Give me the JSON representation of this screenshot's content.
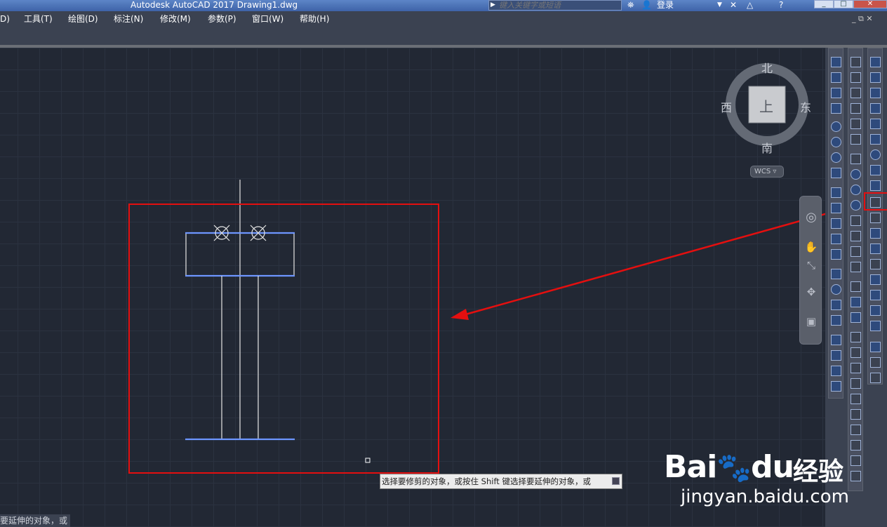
{
  "window": {
    "title": "Autodesk AutoCAD 2017    Drawing1.dwg",
    "search_placeholder": "键入关键字或短语",
    "login_label": "登录",
    "help_label": "?"
  },
  "menu": {
    "items": [
      "D)",
      "工具(T)",
      "绘图(D)",
      "标注(N)",
      "修改(M)",
      "参数(P)",
      "窗口(W)",
      "帮助(H)"
    ],
    "controls": "_ ⧉ ✕"
  },
  "viewcube": {
    "north": "北",
    "south": "南",
    "east": "东",
    "west": "西",
    "face": "上",
    "wcs_label": "WCS"
  },
  "tooltip": {
    "text": "选择要修剪的对象，或按住 Shift 键选择要延伸的对象，或"
  },
  "command_line": {
    "text": "要延伸的对象，或"
  },
  "watermark": {
    "brand": "Bai",
    "brand2": "du",
    "cn": "经验",
    "url": "jingyan.baidu.com"
  },
  "colors": {
    "annotation_red": "#e40f0f",
    "canvas_bg": "#222834",
    "highlight_blue": "#4d7fff"
  },
  "icons": {
    "paw": "paw-icon",
    "pan": "hand-pan-icon",
    "zoom": "zoom-icon",
    "orbit": "orbit-icon",
    "showmotion": "showmotion-icon",
    "steering": "steering-wheel-icon"
  }
}
